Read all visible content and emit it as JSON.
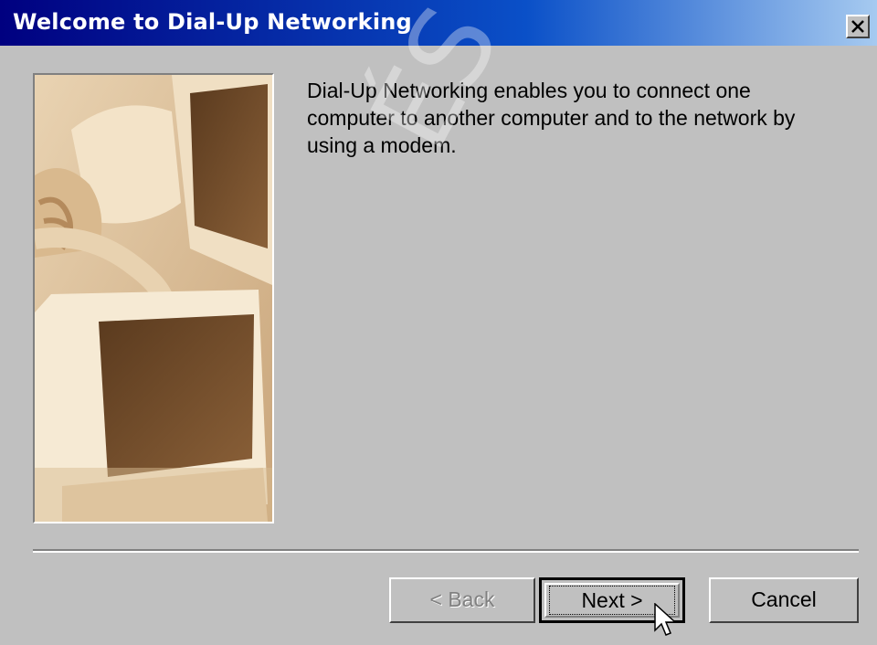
{
  "window": {
    "title": "Welcome to Dial-Up Networking"
  },
  "description": "Dial-Up Networking enables you to connect one computer to another computer and to the network by using a modem.",
  "buttons": {
    "back": "< Back",
    "next": "Next >",
    "cancel": "Cancel"
  },
  "watermark": "ÉS TÁRSA ZR",
  "colors": {
    "titlebar_start": "#000080",
    "titlebar_end": "#a6caf0",
    "dialog_bg": "#c0c0c0"
  },
  "icons": {
    "close": "close-icon",
    "cursor": "arrow-cursor-icon"
  }
}
